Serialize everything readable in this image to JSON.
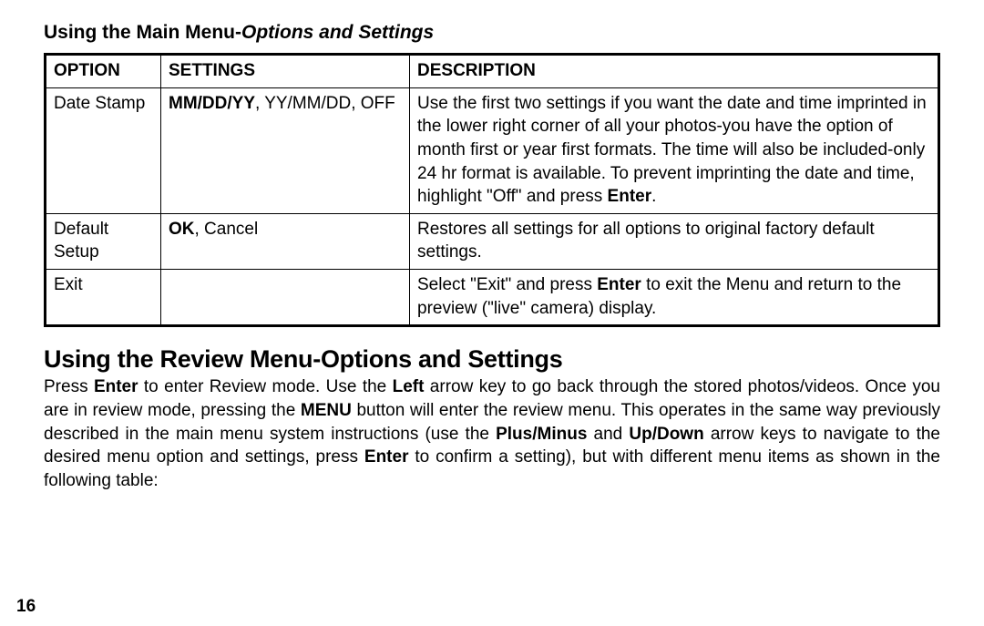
{
  "heading1_prefix": "Using the Main Menu-",
  "heading1_italic": "Options and Settings",
  "table": {
    "headers": {
      "c1": "Option",
      "c2": "Settings",
      "c3": "Description"
    },
    "rows": [
      {
        "option": "Date Stamp",
        "settings_bold": "MM/DD/YY",
        "settings_rest": ", YY/MM/DD, OFF",
        "desc_a": "Use the first two settings if you want the date and time imprinted in the lower right corner of all your photos-you have the option of month first or year first formats. The time will also be included-only 24 hr format is available. To prevent imprinting the date and time, highlight \"Off\" and press ",
        "desc_b_bold": "Enter",
        "desc_c": "."
      },
      {
        "option": "Default Setup",
        "settings_bold": "OK",
        "settings_rest": ", Cancel",
        "desc_a": "Restores all settings for all options to original factory default settings.",
        "desc_b_bold": "",
        "desc_c": ""
      },
      {
        "option": "Exit",
        "settings_bold": "",
        "settings_rest": "",
        "desc_a": "Select \"Exit\" and press ",
        "desc_b_bold": "Enter",
        "desc_c": " to exit the Menu and return to the preview (\"live\" camera) display."
      }
    ]
  },
  "heading2": "Using the Review Menu-Options and Settings",
  "para": {
    "t1": "Press ",
    "b1": "Enter",
    "t2": " to enter Review mode. Use the ",
    "b2": "Left",
    "t3": " arrow key to go back through the stored photos/videos. Once you are in review mode, pressing the ",
    "b3": "MENU",
    "t4": " button will enter the review menu. This operates in the same way previously described in the main menu system instructions (use the ",
    "b4": "Plus/Minus",
    "t5": " and ",
    "b5": "Up/Down",
    "t6": " arrow keys to navigate to the desired menu option and settings, press ",
    "b6": "Enter",
    "t7": " to confirm a setting), but with different menu items as shown in the following table:"
  },
  "page_number": "16"
}
